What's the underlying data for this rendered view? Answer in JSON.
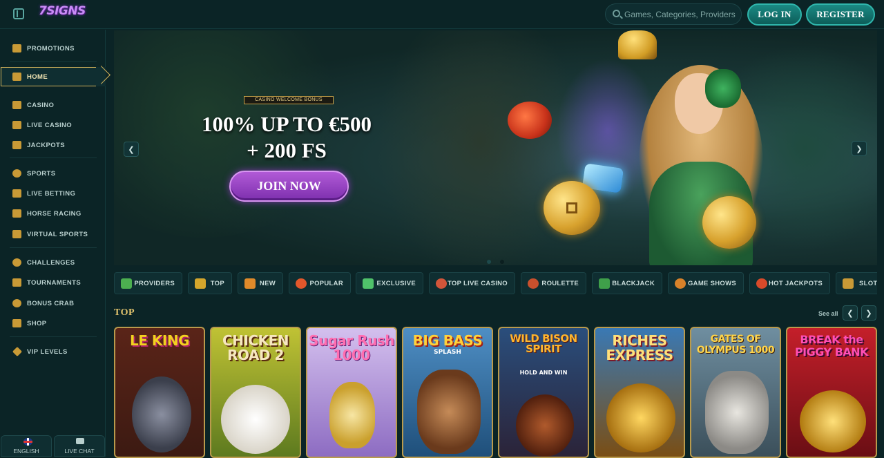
{
  "header": {
    "logo_text": "7SIGNS",
    "search_placeholder": "Games, Categories, Providers",
    "login_label": "LOG IN",
    "register_label": "REGISTER"
  },
  "sidebar": {
    "items": [
      {
        "label": "PROMOTIONS",
        "icon": "gift-icon"
      },
      {
        "label": "HOME",
        "icon": "home-icon",
        "active": true
      },
      {
        "label": "CASINO",
        "icon": "slot-machine-icon"
      },
      {
        "label": "LIVE CASINO",
        "icon": "cards-icon"
      },
      {
        "label": "JACKPOTS",
        "icon": "clover-icon"
      },
      {
        "label": "SPORTS",
        "icon": "ball-icon"
      },
      {
        "label": "LIVE BETTING",
        "icon": "live-icon"
      },
      {
        "label": "HORSE RACING",
        "icon": "horse-icon"
      },
      {
        "label": "VIRTUAL SPORTS",
        "icon": "virtual-icon"
      },
      {
        "label": "CHALLENGES",
        "icon": "medal-icon"
      },
      {
        "label": "TOURNAMENTS",
        "icon": "trophy-icon"
      },
      {
        "label": "BONUS CRAB",
        "icon": "crab-icon"
      },
      {
        "label": "SHOP",
        "icon": "basket-icon"
      },
      {
        "label": "VIP LEVELS",
        "icon": "diamond-icon"
      }
    ],
    "language_label": "ENGLISH",
    "live_chat_label": "LIVE CHAT"
  },
  "banner": {
    "badge": "CASINO WELCOME BONUS",
    "headline_line1": "100% UP TO €500",
    "headline_line2": "+ 200 FS",
    "cta_label": "JOIN NOW",
    "prev_glyph": "❮",
    "next_glyph": "❯",
    "slides": 2,
    "active_slide": 1
  },
  "categories": [
    {
      "label": "PROVIDERS",
      "icon": "providers-icon",
      "color": "#4caf50"
    },
    {
      "label": "TOP",
      "icon": "crown-icon",
      "color": "#d4a62c"
    },
    {
      "label": "NEW",
      "icon": "megaphone-icon",
      "color": "#e08a2a"
    },
    {
      "label": "POPULAR",
      "icon": "fire-icon",
      "color": "#e2572b"
    },
    {
      "label": "EXCLUSIVE",
      "icon": "gem-icon",
      "color": "#4fc16a"
    },
    {
      "label": "TOP LIVE CASINO",
      "icon": "chips-icon",
      "color": "#d2553a"
    },
    {
      "label": "ROULETTE",
      "icon": "roulette-icon",
      "color": "#c9502d"
    },
    {
      "label": "BLACKJACK",
      "icon": "card-icon",
      "color": "#3f9f4a"
    },
    {
      "label": "GAME SHOWS",
      "icon": "mic-icon",
      "color": "#d8822a"
    },
    {
      "label": "HOT JACKPOTS",
      "icon": "hot-jackpot-icon",
      "color": "#d94a2a"
    },
    {
      "label": "SLOTS",
      "icon": "slots-icon",
      "color": "#c99a36"
    }
  ],
  "section": {
    "title": "TOP",
    "see_all_label": "See all",
    "prev_glyph": "❮",
    "next_glyph": "❯"
  },
  "games": [
    {
      "title": "LE KING",
      "subtitle": "",
      "bg": "#3c1a12",
      "color": "#f2d21f"
    },
    {
      "title": "CHICKEN ROAD 2",
      "subtitle": "",
      "bg": "#8a9b2a",
      "color": "#f6e7c0"
    },
    {
      "title": "Sugar Rush 1000",
      "subtitle": "",
      "bg": "#b79ad6",
      "color": "#ff6fb1"
    },
    {
      "title": "BIG BASS",
      "subtitle": "SPLASH",
      "bg": "#2e6ea4",
      "color": "#ffd23a"
    },
    {
      "title": "WILD BISON SPIRIT",
      "subtitle": "HOLD AND WIN",
      "bg": "#213a5e",
      "color": "#ffb62e"
    },
    {
      "title": "RICHES EXPRESS",
      "subtitle": "",
      "bg": "#2b5b8f",
      "color": "#ffe07a"
    },
    {
      "title": "GATES OF OLYMPUS 1000",
      "subtitle": "",
      "bg": "#3c5d6e",
      "color": "#ffd54a"
    },
    {
      "title": "BREAK the PIGGY BANK",
      "subtitle": "",
      "bg": "#9e1a1a",
      "color": "#ff4fb5"
    }
  ]
}
